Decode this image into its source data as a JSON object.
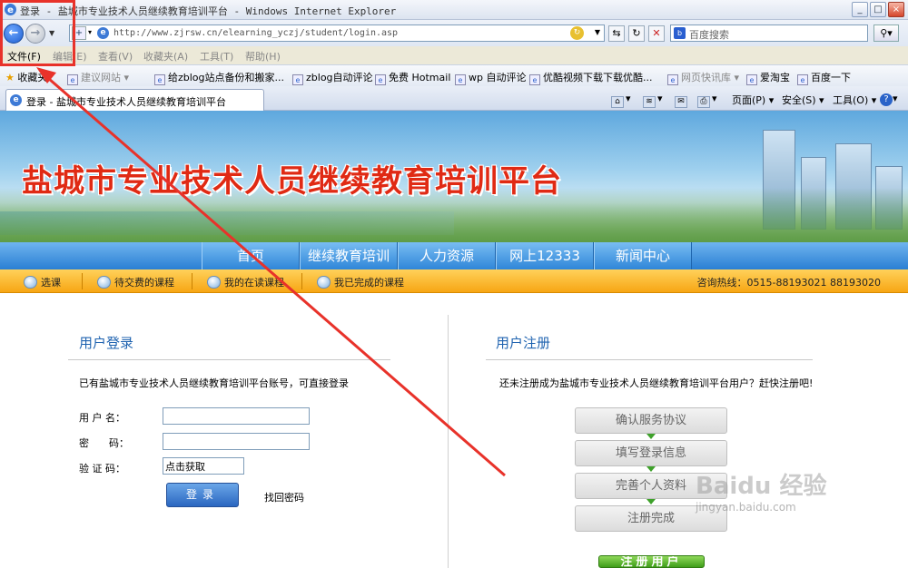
{
  "window": {
    "title": "登录 - 盐城市专业技术人员继续教育培训平台 - Windows Internet Explorer",
    "buttons": [
      "_",
      "□",
      "×"
    ]
  },
  "address": {
    "url": "http://www.zjrsw.cn/elearning_yczj/student/login.asp",
    "search_placeholder": "百度搜索"
  },
  "menu": [
    "文件(F)",
    "编辑(E)",
    "查看(V)",
    "收藏夹(A)",
    "工具(T)",
    "帮助(H)"
  ],
  "favorites": {
    "label": "收藏夹",
    "items": [
      "建议网站 ▾",
      "给zblog站点备份和搬家...",
      "zblog自动评论",
      "免费 Hotmail",
      "wp 自动评论",
      "优酷视频下载下载优酷...",
      "网页快讯库 ▾",
      "爱淘宝",
      "百度一下"
    ]
  },
  "tab": {
    "title": "登录 - 盐城市专业技术人员继续教育培训平台"
  },
  "commands": [
    "页面(P) ▾",
    "安全(S) ▾",
    "工具(O) ▾"
  ],
  "site": {
    "title": "盐城市专业技术人员继续教育培训平台",
    "nav": [
      "首页",
      "继续教育培训",
      "人力资源",
      "网上12333",
      "新闻中心"
    ],
    "subnav": [
      "选课",
      "待交费的课程",
      "我的在读课程",
      "我已完成的课程"
    ],
    "hotline": "咨询热线：0515-88193021 88193020"
  },
  "login": {
    "title": "用户登录",
    "info": "已有盐城市专业技术人员继续教育培训平台账号，可直接登录",
    "username_label": "用 户 名：",
    "password_label": "密　　码：",
    "captcha_label": "验 证 码：",
    "captcha_value": "点击获取",
    "submit": "登录",
    "forgot": "找回密码"
  },
  "register": {
    "title": "用户注册",
    "info": "还未注册成为盐城市专业技术人员继续教育培训平台用户？赶快注册吧!",
    "steps": [
      "确认服务协议",
      "填写登录信息",
      "完善个人资料",
      "注册完成"
    ],
    "button": "注册用户"
  },
  "watermark": {
    "brand": "Baidu 经验",
    "url": "jingyan.baidu.com"
  },
  "annotation": {
    "color": "#e8322a"
  }
}
